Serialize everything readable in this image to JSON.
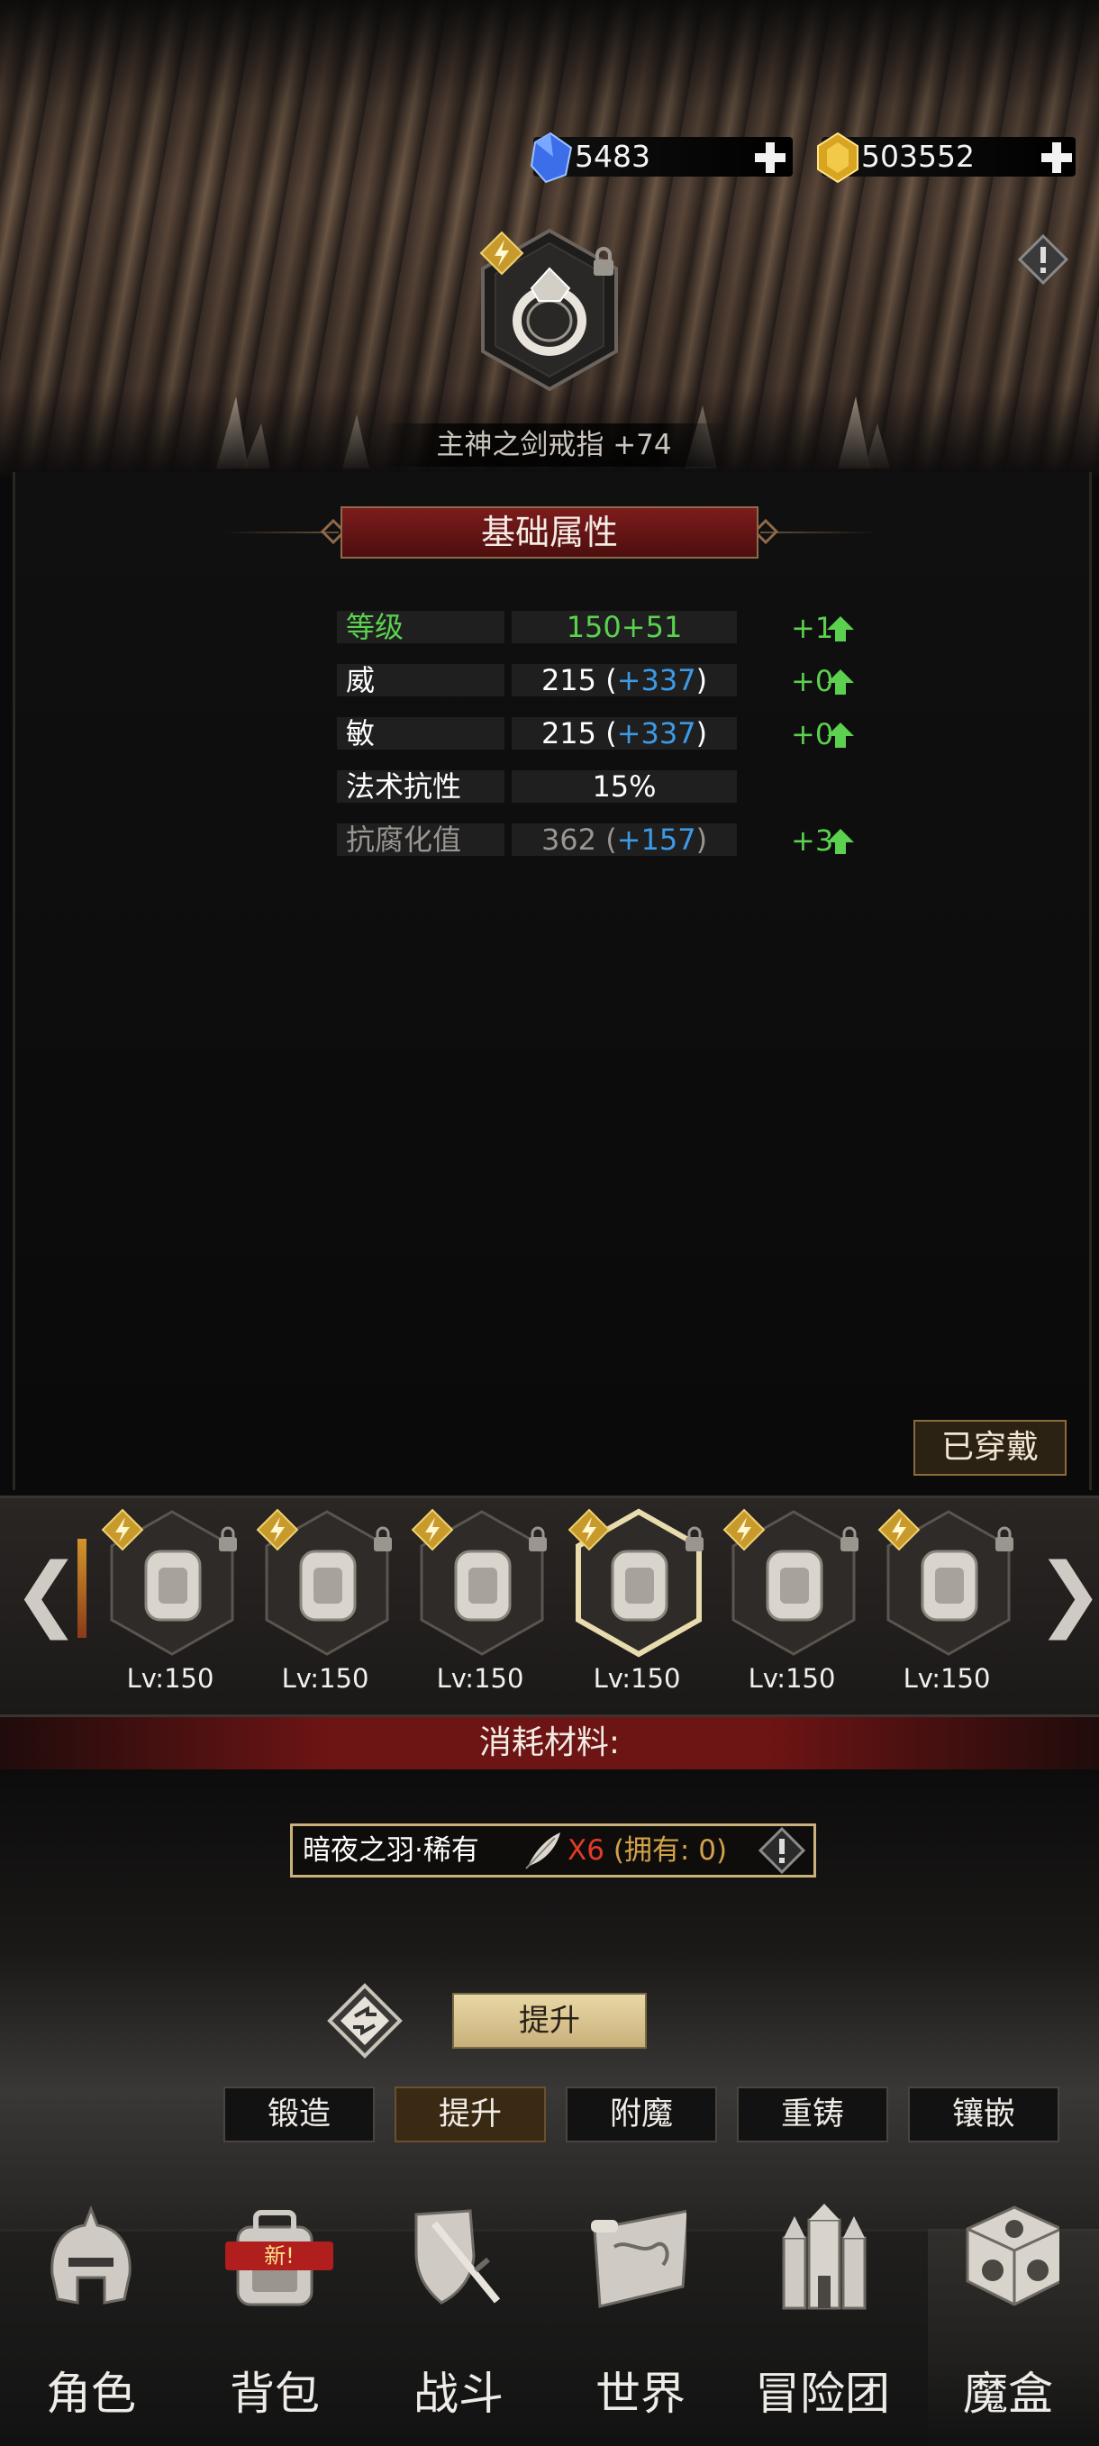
{
  "currency": {
    "gems": {
      "icon": "blue-crystal-icon",
      "value": "5483"
    },
    "gold": {
      "icon": "gold-crystal-icon",
      "value": "503552"
    }
  },
  "item": {
    "name": "主神之剑戒指 +74",
    "icon": "ring-icon",
    "badge_icon": "lightning-badge-icon",
    "locked": true
  },
  "section_title": "基础属性",
  "attributes": [
    {
      "label": "等级",
      "value": "150+51",
      "bonus": "",
      "increase": "+1",
      "label_color": "#5bd14f",
      "value_color": "#5bd14f"
    },
    {
      "label": "威",
      "value": "215",
      "bonus": "+337",
      "increase": "+0",
      "label_color": "#ffffff",
      "value_color": "#ffffff"
    },
    {
      "label": "敏",
      "value": "215",
      "bonus": "+337",
      "increase": "+0",
      "label_color": "#ffffff",
      "value_color": "#ffffff"
    },
    {
      "label": "法术抗性",
      "value": "15%",
      "bonus": "",
      "increase": "",
      "label_color": "#ffffff",
      "value_color": "#ffffff"
    },
    {
      "label": "抗腐化值",
      "value": "362",
      "bonus": "+157",
      "increase": "+3",
      "label_color": "#9a9590",
      "value_color": "#9a9590"
    }
  ],
  "bonus_color": "#3c9be8",
  "equipped_label": "已穿戴",
  "equipment_slots": [
    {
      "icon": "chest-armor-icon",
      "level": "Lv:150",
      "selected": false
    },
    {
      "icon": "gauntlet-icon",
      "level": "Lv:150",
      "selected": false
    },
    {
      "icon": "boots-icon",
      "level": "Lv:150",
      "selected": false
    },
    {
      "icon": "ring-icon",
      "level": "Lv:150",
      "selected": true
    },
    {
      "icon": "belt-icon",
      "level": "Lv:150",
      "selected": false
    },
    {
      "icon": "cloak-icon",
      "level": "Lv:150",
      "selected": false
    }
  ],
  "consume_title": "消耗材料:",
  "material": {
    "name": "暗夜之羽·稀有",
    "icon": "feather-icon",
    "count": "X6",
    "owned": "(拥有: 0)"
  },
  "promote_button": "提升",
  "tabs": [
    {
      "label": "锻造",
      "active": false
    },
    {
      "label": "提升",
      "active": true
    },
    {
      "label": "附魔",
      "active": false
    },
    {
      "label": "重铸",
      "active": false
    },
    {
      "label": "镶嵌",
      "active": false
    }
  ],
  "nav": [
    {
      "label": "角色",
      "icon": "helmet-icon"
    },
    {
      "label": "背包",
      "icon": "backpack-icon",
      "badge": "新!"
    },
    {
      "label": "战斗",
      "icon": "shield-sword-icon"
    },
    {
      "label": "世界",
      "icon": "map-icon"
    },
    {
      "label": "冒险团",
      "icon": "castle-icon"
    },
    {
      "label": "魔盒",
      "icon": "cube-icon",
      "active": true
    }
  ]
}
